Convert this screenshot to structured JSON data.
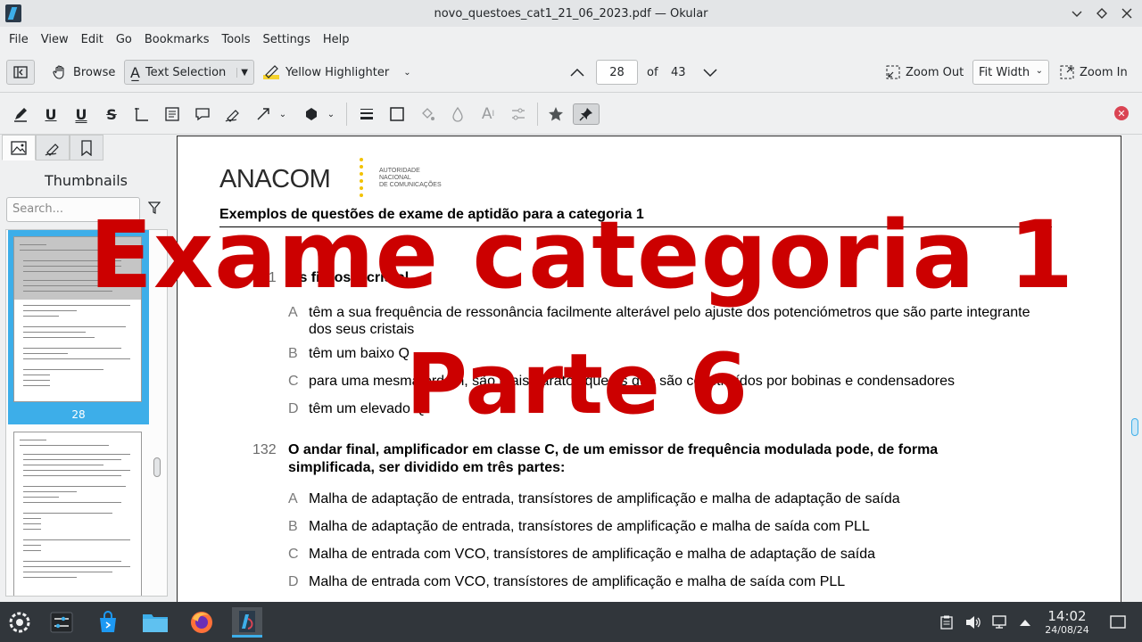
{
  "window": {
    "title": "novo_questoes_cat1_21_06_2023.pdf — Okular",
    "controls": [
      "minimize",
      "maximize",
      "close"
    ]
  },
  "menu": [
    "File",
    "View",
    "Edit",
    "Go",
    "Bookmarks",
    "Tools",
    "Settings",
    "Help"
  ],
  "toolbar": {
    "browse": "Browse",
    "text_selection": "Text Selection",
    "highlighter": "Yellow Highlighter",
    "page_current": "28",
    "page_of": "of",
    "page_total": "43",
    "zoom_out": "Zoom Out",
    "zoom_mode": "Fit Width",
    "zoom_in": "Zoom In"
  },
  "sidebar": {
    "title": "Thumbnails",
    "search_placeholder": "Search...",
    "selected_page": "28"
  },
  "document": {
    "logo": "ANACOM",
    "logo_sub": [
      "AUTORIDADE",
      "NACIONAL",
      "DE COMUNICAÇÕES"
    ],
    "heading": "Exemplos de questões de exame de aptidão para a categoria  1",
    "q131": {
      "number": "131",
      "stem": "Os filtros a cristal",
      "options": [
        {
          "letter": "A",
          "text": "têm a sua frequência de  ressonância  facilmente alterável pelo ajuste dos potenciómetros que são parte integrante dos seus cristais"
        },
        {
          "letter": "B",
          "text": "têm um baixo Q"
        },
        {
          "letter": "C",
          "text": "para uma mesma ordem, são mais baratos que os que são constituídos por bobinas e condensadores"
        },
        {
          "letter": "D",
          "text": "têm um elevado Q"
        }
      ]
    },
    "q132": {
      "number": "132",
      "stem": "O andar final, amplificador em classe C, de um emissor de frequência modulada pode, de forma simplificada, ser dividido em três partes:",
      "options": [
        {
          "letter": "A",
          "text": "Malha de adaptação de entrada, transístores de amplificação e malha de adaptação de saída"
        },
        {
          "letter": "B",
          "text": "Malha de adaptação de entrada, transístores de amplificação e malha de saída com PLL"
        },
        {
          "letter": "C",
          "text": "Malha de entrada com VCO, transístores de amplificação e malha de adaptação de saída"
        },
        {
          "letter": "D",
          "text": "Malha de entrada com VCO, transístores de amplificação e malha de saída com PLL"
        }
      ]
    }
  },
  "overlay": {
    "line1": "Exame categoria 1",
    "line2": "Parte 6"
  },
  "taskbar": {
    "time": "14:02",
    "date": "24/08/24"
  },
  "colors": {
    "overlay_red": "#cc0000",
    "accent_blue": "#3daee9",
    "taskbar": "#31363b"
  }
}
